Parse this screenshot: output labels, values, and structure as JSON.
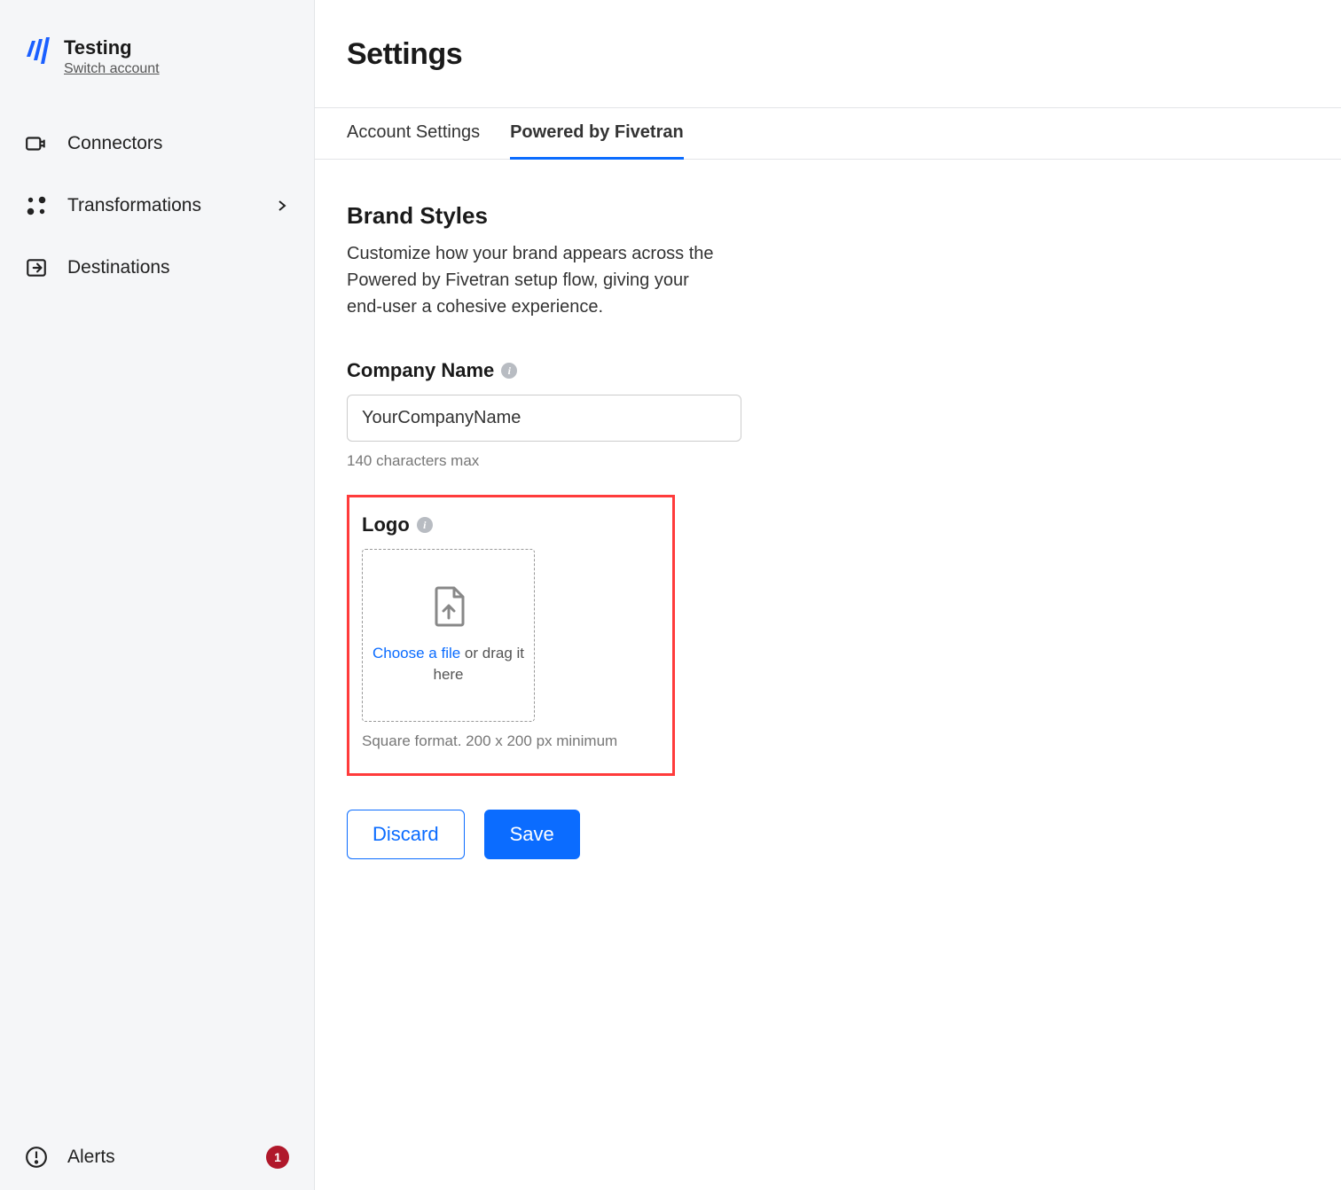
{
  "account": {
    "name": "Testing",
    "switch_label": "Switch account"
  },
  "sidebar": {
    "items": [
      {
        "label": "Connectors"
      },
      {
        "label": "Transformations"
      },
      {
        "label": "Destinations"
      }
    ],
    "alerts_label": "Alerts",
    "alerts_count": "1"
  },
  "page": {
    "title": "Settings"
  },
  "tabs": [
    {
      "label": "Account Settings"
    },
    {
      "label": "Powered by Fivetran"
    }
  ],
  "brand": {
    "section_title": "Brand Styles",
    "section_desc": "Customize how your brand appears across the Powered by Fivetran setup flow, giving your end-user a cohesive experience.",
    "company_label": "Company Name",
    "company_value": "YourCompanyName",
    "company_helper": "140 characters max",
    "logo_label": "Logo",
    "upload_link": "Choose a file",
    "upload_rest": " or drag it here",
    "logo_helper": "Square format. 200 x 200 px minimum"
  },
  "buttons": {
    "discard": "Discard",
    "save": "Save"
  }
}
